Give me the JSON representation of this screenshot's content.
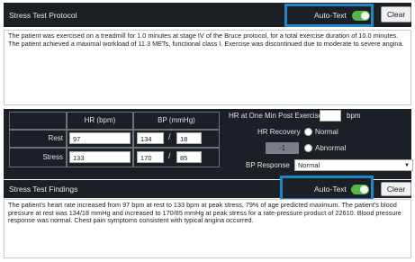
{
  "protocol": {
    "title": "Stress Test Protocol",
    "autotext_label": "Auto-Text",
    "clear_label": "Clear",
    "text": "The patient was exercised on a treadmill for 1.0 minutes at stage IV of the Bruce protocol, for a total exercise duration of 10.0 minutes. The patient achieved a maximal workload of 11.3 METs, functional class I. Exercise was discontinued due to moderate to severe angina."
  },
  "vitals": {
    "headers": {
      "hr": "HR (bpm)",
      "bp": "BP (mmHg)"
    },
    "rows": [
      {
        "label": "Rest",
        "hr": "97",
        "bp_sys": "134",
        "bp_dia": "18"
      },
      {
        "label": "Stress",
        "hr": "133",
        "bp_sys": "170",
        "bp_dia": "85"
      }
    ],
    "slash": "/",
    "hr_post_label": "HR at One Min Post Exercise",
    "hr_post_value": "",
    "hr_post_unit": "bpm",
    "hr_recovery_label": "HR Recovery",
    "recovery_value": "-1",
    "normal_label": "Normal",
    "abnormal_label": "Abnormal",
    "bp_response_label": "BP Response",
    "bp_response_value": "Normal"
  },
  "findings": {
    "title": "Stress Test Findings",
    "autotext_label": "Auto-Text",
    "clear_label": "Clear",
    "text": "The patient's heart rate increased from 97 bpm at rest to 133 bpm at peak stress, 79% of age predicted maximum. The patient's blood pressure at rest was 134/18 mmHg and increased to 170/85 mmHg at peak stress for a rate-pressure product of 22610. Blood pressure response was normal. Chest pain symptoms consistent with typical angina occurred."
  },
  "colors": {
    "header_bg": "#1b2027",
    "highlight": "#1f86c9",
    "toggle_on": "#55b64a"
  }
}
